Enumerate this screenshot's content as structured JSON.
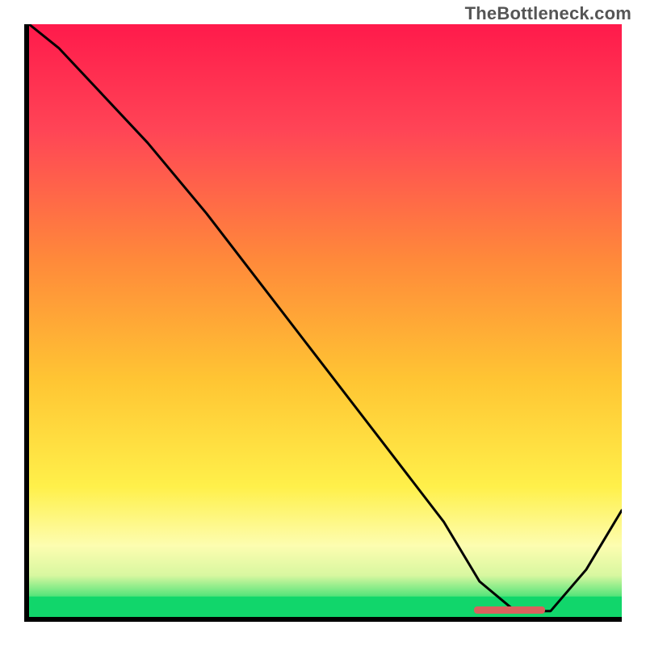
{
  "watermark": "TheBottleneck.com",
  "chart_data": {
    "type": "line",
    "title": "",
    "xlabel": "",
    "ylabel": "",
    "xlim": [
      0,
      100
    ],
    "ylim": [
      0,
      100
    ],
    "grid": false,
    "legend": false,
    "background_gradient": {
      "description": "vertical gradient red→orange→yellow→pale-yellow→green, bottom ~3% solid green",
      "stops": [
        {
          "pos": 0.0,
          "color": "#ff1a4b"
        },
        {
          "pos": 0.18,
          "color": "#ff4556"
        },
        {
          "pos": 0.4,
          "color": "#ff8a3a"
        },
        {
          "pos": 0.6,
          "color": "#ffc533"
        },
        {
          "pos": 0.78,
          "color": "#fff04a"
        },
        {
          "pos": 0.88,
          "color": "#fdfdb0"
        },
        {
          "pos": 0.93,
          "color": "#d8f7a0"
        },
        {
          "pos": 0.965,
          "color": "#55e47a"
        },
        {
          "pos": 0.966,
          "color": "#11d66b"
        },
        {
          "pos": 1.0,
          "color": "#11d66b"
        }
      ]
    },
    "series": [
      {
        "name": "bottleneck-curve",
        "color": "#000000",
        "x": [
          0,
          5,
          20,
          30,
          40,
          50,
          60,
          70,
          76,
          82,
          88,
          94,
          100
        ],
        "y": [
          100,
          96,
          80,
          68,
          55,
          42,
          29,
          16,
          6,
          1,
          1,
          8,
          18
        ]
      }
    ],
    "annotations": [
      {
        "name": "optimal-range-marker",
        "type": "hbar",
        "y": 1.2,
        "x_start": 75,
        "x_end": 87,
        "color": "#d9615d"
      }
    ]
  }
}
